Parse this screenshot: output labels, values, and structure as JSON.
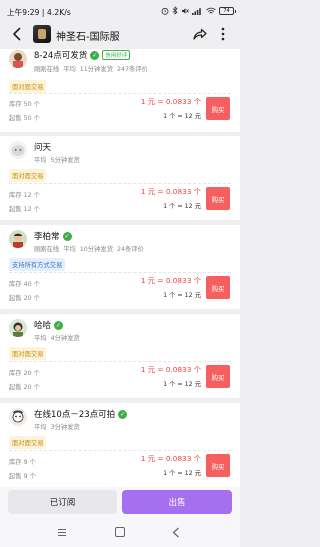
{
  "status_bar": {
    "time": "上午9:29 | 4.2K/s",
    "battery": "74",
    "icons": [
      "alarm-icon",
      "bluetooth-icon",
      "mute-icon",
      "signal-icon",
      "wifi-icon",
      "battery-icon"
    ]
  },
  "nav": {
    "title": "神圣石-国际服",
    "icons": [
      "back-icon",
      "share-icon",
      "more-icon"
    ]
  },
  "sellers": [
    {
      "name": "8-24点可发货",
      "extra_badge": "信用好评",
      "meta": "刚刚在线  平均 11分钟发货  247条评价",
      "tag": "面对面交易",
      "tag_style": "yellow",
      "stock": "库存 50 个",
      "min": "起售 50 个",
      "price": "1 元 = 0.0833 个",
      "ratio": "1 个 = 12 元",
      "buy_label": "购买"
    },
    {
      "name": "问天",
      "meta": "平均 5分钟发货",
      "tag": "面对面交易",
      "tag_style": "yellow",
      "stock": "库存 12 个",
      "min": "起售 12 个",
      "price": "1 元 = 0.0833 个",
      "ratio": "1 个 = 12 元",
      "buy_label": "购买"
    },
    {
      "name": "李柏常",
      "meta": "刚刚在线  平均 10分钟发货  24条评价",
      "tag": "支持所有方式交易",
      "tag_style": "blue",
      "stock": "库存 40 个",
      "min": "起售 20 个",
      "price": "1 元 = 0.0833 个",
      "ratio": "1 个 = 12 元",
      "buy_label": "购买"
    },
    {
      "name": "哈哈",
      "meta": "平均 4分钟发货",
      "tag": "面对面交易",
      "tag_style": "yellow",
      "stock": "库存 20 个",
      "min": "起售 20 个",
      "price": "1 元 = 0.0833 个",
      "ratio": "1 个 = 12 元",
      "buy_label": "购买"
    },
    {
      "name": "在线10点－23点可拍",
      "meta": "平均 3分钟发货",
      "tag": "面对面交易",
      "tag_style": "yellow",
      "stock": "库存 9 个",
      "min": "起售 9 个",
      "price": "1 元 = 0.0833 个",
      "ratio": "1 个 = 12 元",
      "buy_label": "购买"
    }
  ],
  "bottom": {
    "subscribe_label": "已订阅",
    "sell_label": "出售"
  },
  "colors": {
    "price": "#f04343",
    "buy_button": "#f65f5f",
    "sell_button": "#a56ff0",
    "verified": "#3fae49",
    "tag_yellow_text": "#c68f16",
    "tag_blue_text": "#3c77d0"
  }
}
